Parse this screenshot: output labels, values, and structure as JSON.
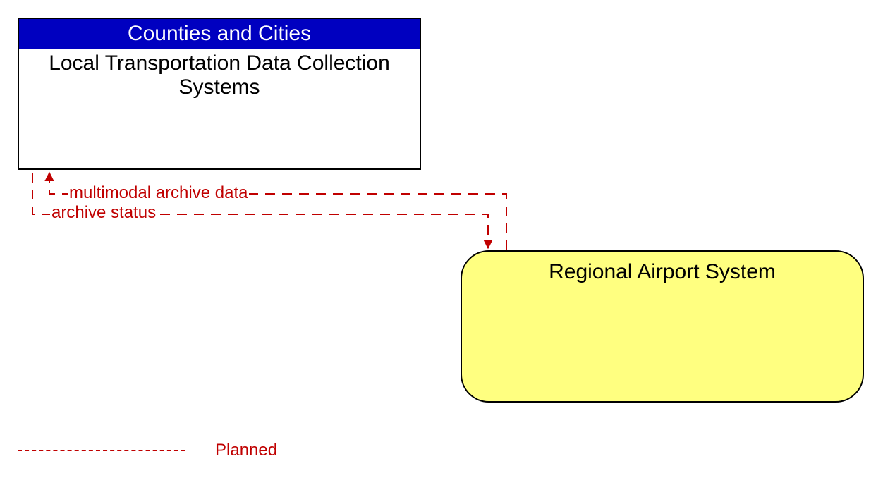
{
  "boxes": {
    "local": {
      "header": "Counties and Cities",
      "body": "Local Transportation Data Collection Systems"
    },
    "airport": {
      "title": "Regional Airport System"
    }
  },
  "flows": {
    "multimodal": "multimodal archive data",
    "archive_status": "archive status"
  },
  "legend": {
    "planned": "Planned"
  },
  "colors": {
    "header_bg": "#0000c0",
    "airport_fill": "#ffff80",
    "flow_color": "#c00000"
  }
}
